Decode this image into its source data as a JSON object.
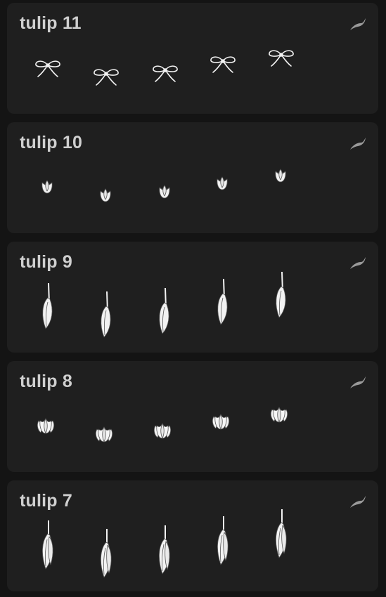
{
  "brushes": [
    {
      "title": "tulip 11",
      "stamp_icon": "bow-icon",
      "settings_icon": "brush-stroke-icon"
    },
    {
      "title": "tulip 10",
      "stamp_icon": "tulip-bud-icon",
      "settings_icon": "brush-stroke-icon"
    },
    {
      "title": "tulip 9",
      "stamp_icon": "tulip-leaf-icon",
      "settings_icon": "brush-stroke-icon"
    },
    {
      "title": "tulip 8",
      "stamp_icon": "tulip-bloom-icon",
      "settings_icon": "brush-stroke-icon"
    },
    {
      "title": "tulip 7",
      "stamp_icon": "tulip-leaves-icon",
      "settings_icon": "brush-stroke-icon"
    }
  ],
  "colors": {
    "background": "#141414",
    "card": "#1f1f1f",
    "title": "#cfcfcf",
    "stamp": "#f2f2f2"
  }
}
